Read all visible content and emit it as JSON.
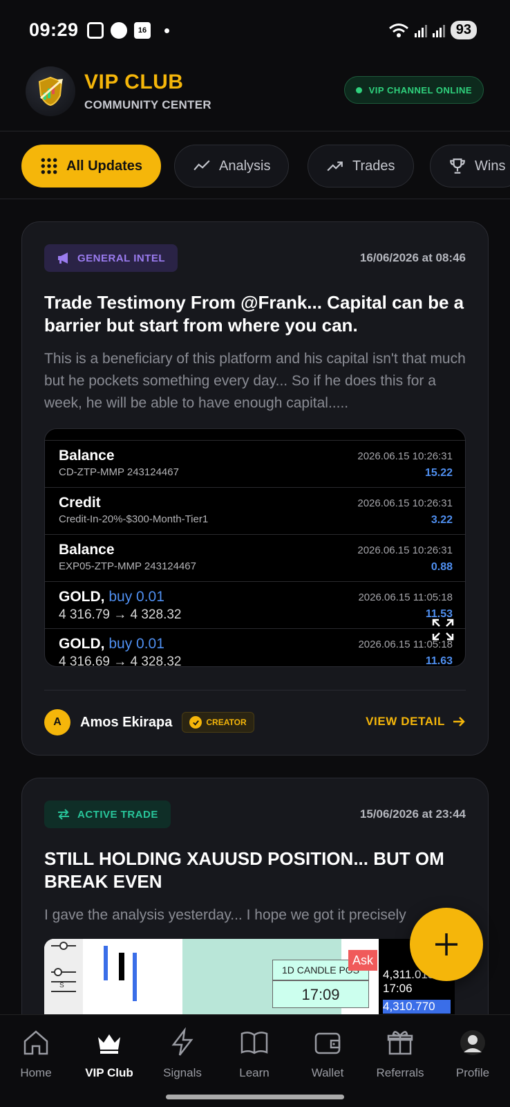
{
  "status": {
    "time": "09:29",
    "calendar_day": "16",
    "battery": "93"
  },
  "header": {
    "title": "VIP CLUB",
    "subtitle": "COMMUNITY CENTER",
    "online_label": "VIP CHANNEL ONLINE"
  },
  "tabs": [
    {
      "label": "All Updates"
    },
    {
      "label": "Analysis"
    },
    {
      "label": "Trades"
    },
    {
      "label": "Wins"
    }
  ],
  "posts": [
    {
      "badge": "GENERAL INTEL",
      "date": "16/06/2026 at 08:46",
      "title": "Trade Testimony From @Frank... Capital can be a barrier but start from where you can.",
      "body": "This is a beneficiary of this platform and his capital isn't that much but  he pockets something every day... So if he does this for a week, he will be able to have enough capital.....",
      "statement_rows": [
        {
          "title": "Balance",
          "sub": "CD-ZTP-MMP 243124467",
          "time": "2026.06.15 10:26:31",
          "value": "15.22"
        },
        {
          "title": "Credit",
          "sub": "Credit-In-20%-$300-Month-Tier1",
          "time": "2026.06.15 10:26:31",
          "value": "3.22"
        },
        {
          "title": "Balance",
          "sub": "EXP05-ZTP-MMP 243124467",
          "time": "2026.06.15 10:26:31",
          "value": "0.88"
        },
        {
          "title": "GOLD,",
          "buy": "buy 0.01",
          "sub": "4 316.79 → 4 328.32",
          "time": "2026.06.15 11:05:18",
          "value": "11.53"
        },
        {
          "title": "GOLD,",
          "buy": "buy 0.01",
          "sub": "4 316.69 → 4 328.32",
          "time": "2026.06.15 11:05:18",
          "value": "11.63"
        }
      ],
      "author": {
        "initial": "A",
        "name": "Amos Ekirapa",
        "role": "CREATOR"
      },
      "view_label": "VIEW DETAIL"
    },
    {
      "badge": "ACTIVE TRADE",
      "date": "15/06/2026 at 23:44",
      "title": "STILL HOLDING XAUUSD POSITION... BUT OM BREAK EVEN",
      "body": "I gave the analysis yesterday... I hope we got it precisely",
      "chart_labels": {
        "candle": "1D CANDLE POS",
        "timer": "17:09",
        "ask": "Ask",
        "ask_price": "4,311.015",
        "ask_time": "17:06",
        "bid_price": "4,310.770",
        "slider_s": "S"
      }
    }
  ],
  "nav": [
    {
      "label": "Home"
    },
    {
      "label": "VIP Club"
    },
    {
      "label": "Signals"
    },
    {
      "label": "Learn"
    },
    {
      "label": "Wallet"
    },
    {
      "label": "Referrals"
    },
    {
      "label": "Profile"
    }
  ]
}
